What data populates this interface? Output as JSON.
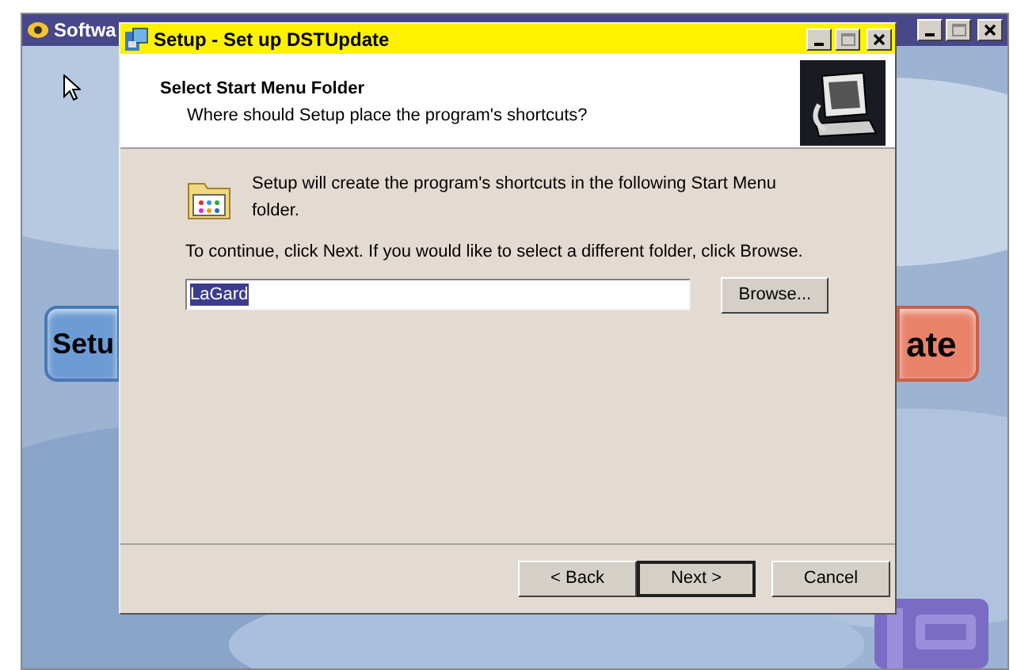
{
  "main_window": {
    "title": "Softwa",
    "buttons": [
      {
        "label": "Setu",
        "kind": "blue"
      },
      {
        "label": "ate",
        "kind": "orange"
      }
    ]
  },
  "setup_dialog": {
    "title": "Setup - Set up DSTUpdate",
    "header_title": "Select Start Menu Folder",
    "header_subtitle": "Where should Setup place the program's shortcuts?",
    "info_text": "Setup will create the program's shortcuts in the following Start Menu folder.",
    "instruction": "To continue, click Next. If you would like to select a different folder, click Browse.",
    "folder_field": {
      "value": "LaGard",
      "text_selected": true
    },
    "browse_button": "Browse...",
    "buttons": [
      {
        "label": "< Back",
        "default": false
      },
      {
        "label": "Next >",
        "default": true
      },
      {
        "label": "Cancel",
        "default": false
      }
    ]
  }
}
